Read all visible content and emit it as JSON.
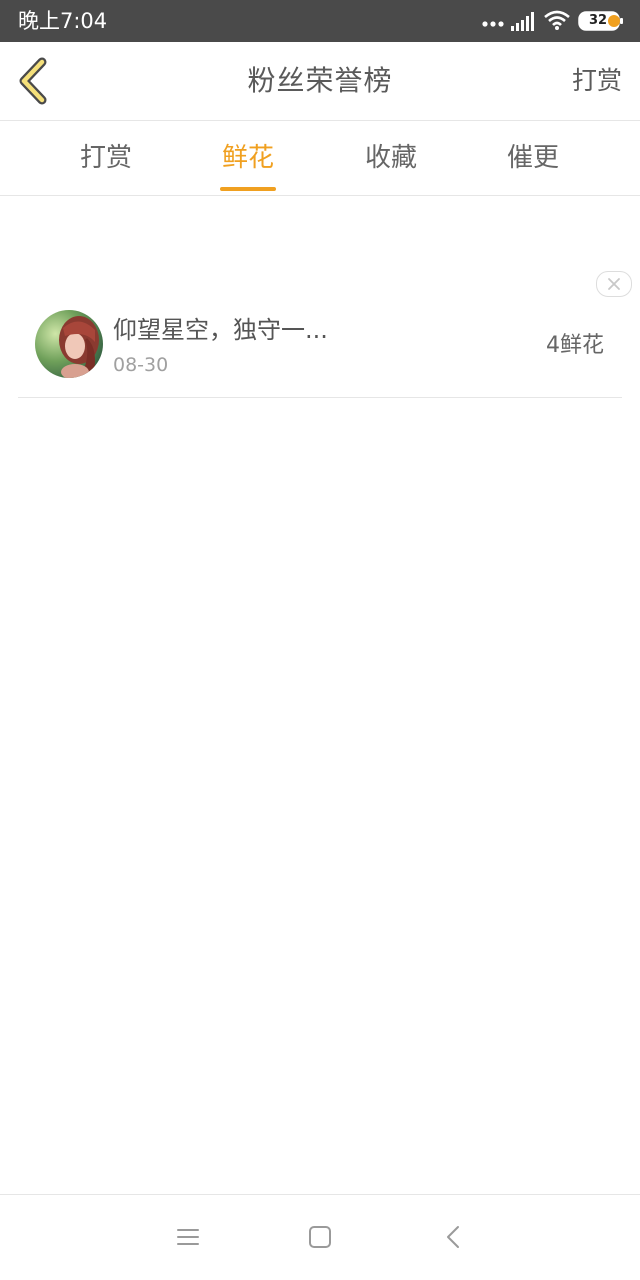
{
  "status_bar": {
    "time": "晚上7:04",
    "battery_level": "32",
    "icons": [
      "more-dots-icon",
      "signal-icon",
      "wifi-icon",
      "battery-icon"
    ]
  },
  "header": {
    "title": "粉丝荣誉榜",
    "right_action": "打赏",
    "back_icon": "chevron-left-icon"
  },
  "tabs": [
    {
      "label": "打赏",
      "active": false
    },
    {
      "label": "鲜花",
      "active": true
    },
    {
      "label": "收藏",
      "active": false
    },
    {
      "label": "催更",
      "active": false
    }
  ],
  "list": {
    "items": [
      {
        "name": "仰望星空，独守一...",
        "date": "08-30",
        "amount": "4鲜花",
        "avatar": "avatar-photo"
      }
    ],
    "dismiss_icon": "close-icon"
  },
  "nav_bar": {
    "buttons": [
      "menu-icon",
      "home-square-icon",
      "back-arrow-icon"
    ]
  },
  "colors": {
    "accent": "#f0a020",
    "status_bar": "#4a4a4a",
    "text_primary": "#555555",
    "text_secondary": "#a0a0a0",
    "divider": "#e6e6e6"
  }
}
